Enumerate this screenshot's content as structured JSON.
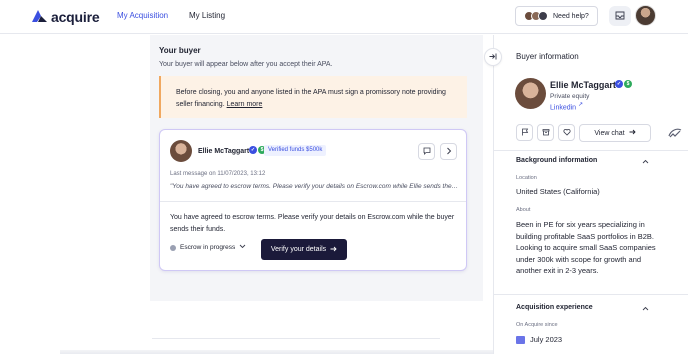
{
  "nav": {
    "brand": "acquire",
    "links": [
      "My Acquisition",
      "My Listing"
    ],
    "help_label": "Need help?"
  },
  "main": {
    "section_title": "Your buyer",
    "section_subtitle": "Your buyer will appear below after you accept their APA.",
    "notice_text": "Before closing, you and anyone listed in the APA must sign a promissory note providing seller financing.",
    "notice_link": "Learn more",
    "card": {
      "buyer_name": "Ellie McTaggart",
      "verified_funds": "Verified funds $500k",
      "last_message": "Last message on 11/07/2023, 13:12",
      "message_preview": "\"You have agreed to escrow terms. Please verify your details on Escrow.com while Ellie sends the…",
      "body_text": "You have agreed to escrow terms. Please verify your details on Escrow.com while the buyer sends their funds.",
      "escrow_status": "Escrow in progress",
      "verify_button": "Verify your details"
    }
  },
  "side": {
    "title": "Buyer information",
    "buyer_name": "Ellie McTaggart",
    "buyer_type": "Private equity",
    "linkedin": "Linkedin",
    "view_chat": "View chat",
    "background": {
      "heading": "Background information",
      "location_label": "Location",
      "location_value": "United States (California)",
      "about_label": "About",
      "about_value": "Been in PE for six years specializing in building profitable SaaS portfolios in B2B. Looking to acquire small SaaS companies under 300k with scope for growth and another exit in 2-3 years."
    },
    "acquisition": {
      "heading": "Acquisition experience",
      "since_label": "On Acquire since",
      "since_value": "July 2023"
    }
  },
  "colors": {
    "accent": "#3b4fe0",
    "dark_button": "#1b1a3a",
    "notice_bg": "#fdf2e6",
    "notice_border": "#f0a860",
    "badge_blue": "#3b4fe0",
    "badge_green": "#2eaa5c"
  },
  "icons": [
    "acquire-logo-icon",
    "inbox-icon",
    "chat-icon",
    "chevron-right-icon",
    "arrow-right-icon",
    "chevron-down-icon",
    "collapse-panel-icon",
    "flag-icon",
    "archive-icon",
    "heart-icon",
    "chevron-up-icon",
    "calendar-icon",
    "verified-badge-icon"
  ]
}
